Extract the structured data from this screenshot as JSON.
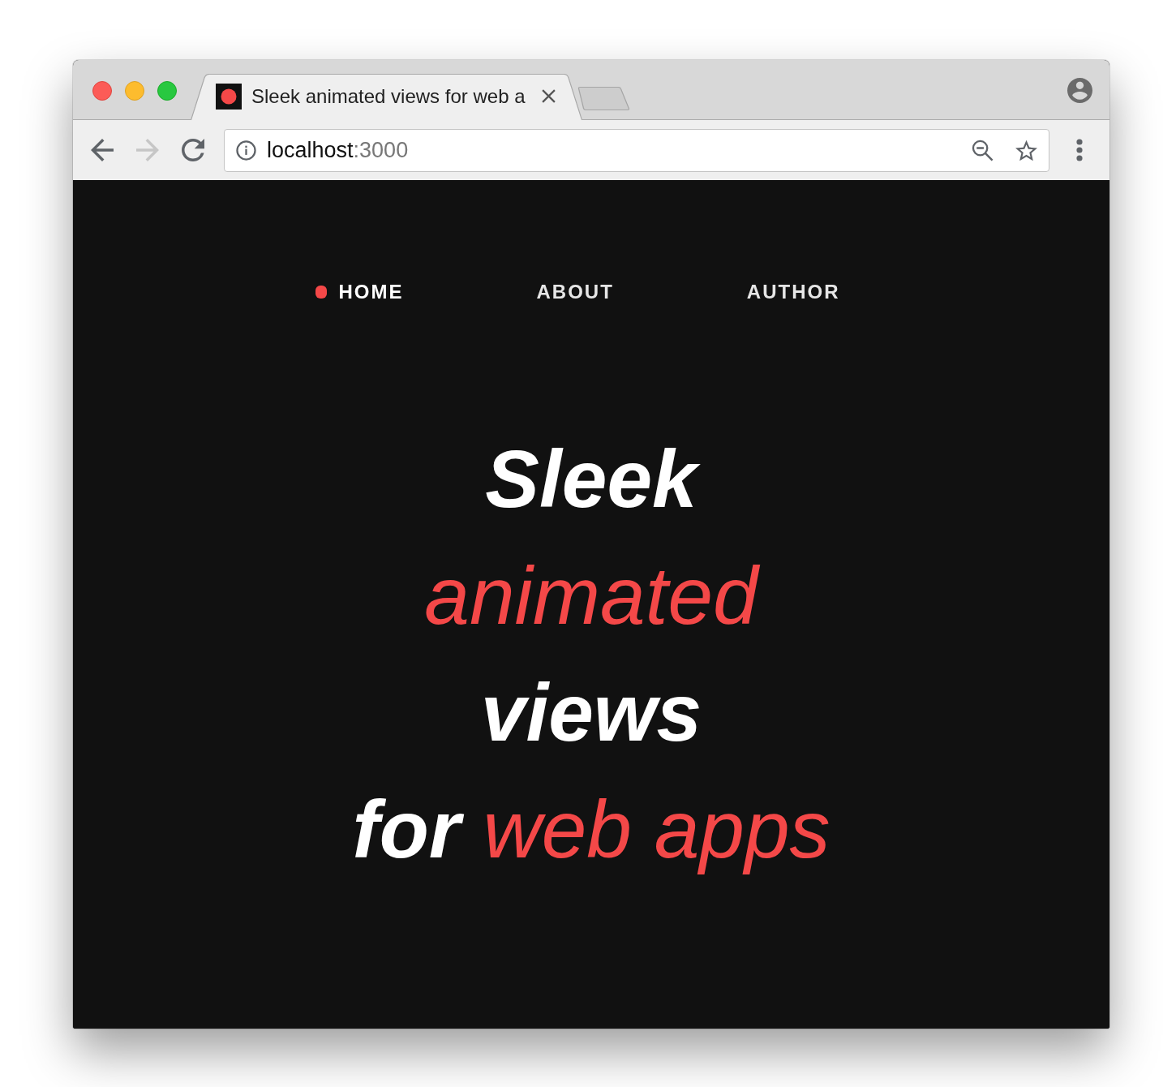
{
  "tabs": [
    {
      "title": "Sleek animated views for web a",
      "selected": true
    }
  ],
  "toolbar": {
    "buttons": [
      {
        "kind": "back",
        "disabled": false
      },
      {
        "kind": "forward",
        "disabled": true
      },
      {
        "kind": "reload",
        "disabled": false
      }
    ],
    "address": {
      "host": "localhost",
      "port": ":3000"
    }
  },
  "page": {
    "nav": [
      {
        "label": "HOME",
        "selected": true
      },
      {
        "label": "ABOUT",
        "selected": false
      },
      {
        "label": "AUTHOR",
        "selected": false
      }
    ],
    "headline": [
      {
        "segments": [
          {
            "text": "Sleek",
            "kind": "strong"
          }
        ]
      },
      {
        "segments": [
          {
            "text": "animated",
            "kind": "accent"
          }
        ]
      },
      {
        "segments": [
          {
            "text": "views",
            "kind": "strong"
          }
        ]
      },
      {
        "segments": [
          {
            "text": "for",
            "kind": "strong"
          },
          {
            "text": "web apps",
            "kind": "accent"
          }
        ]
      }
    ]
  }
}
